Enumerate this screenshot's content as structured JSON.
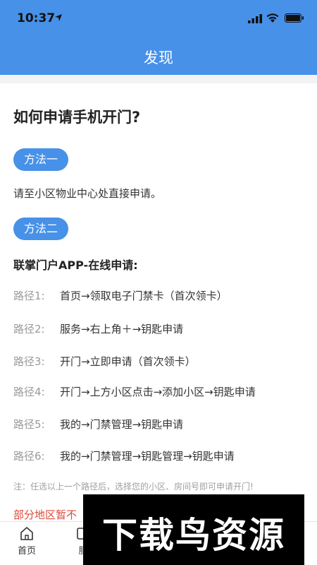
{
  "status": {
    "time": "10:37"
  },
  "nav": {
    "title": "发现"
  },
  "page": {
    "title": "如何申请手机开门?"
  },
  "method1": {
    "badge": "方法一",
    "text": "请至小区物业中心处直接申请。"
  },
  "method2": {
    "badge": "方法二",
    "heading": "联掌门户APP-在线申请:"
  },
  "routes": [
    {
      "label": "路径1:",
      "value": "首页→领取电子门禁卡（首次领卡）"
    },
    {
      "label": "路径2:",
      "value": "服务→右上角＋→钥匙申请"
    },
    {
      "label": "路径3:",
      "value": "开门→立即申请（首次领卡）"
    },
    {
      "label": "路径4:",
      "value": "开门→上方小区点击→添加小区→钥匙申请"
    },
    {
      "label": "路径5:",
      "value": "我的→门禁管理→钥匙申请"
    },
    {
      "label": "路径6:",
      "value": "我的→门禁管理→钥匙管理→钥匙申请"
    }
  ],
  "note": "注：任选以上一个路径后，选择您的小区、房间号即可申请开门!",
  "warning": "部分地区暂不",
  "tabs": [
    {
      "label": "首页",
      "icon": "home-icon"
    },
    {
      "label": "服",
      "icon": "service-icon"
    }
  ],
  "watermark": "下载鸟资源",
  "colors": {
    "accent": "#4791e8",
    "warning": "#d94a3a"
  }
}
